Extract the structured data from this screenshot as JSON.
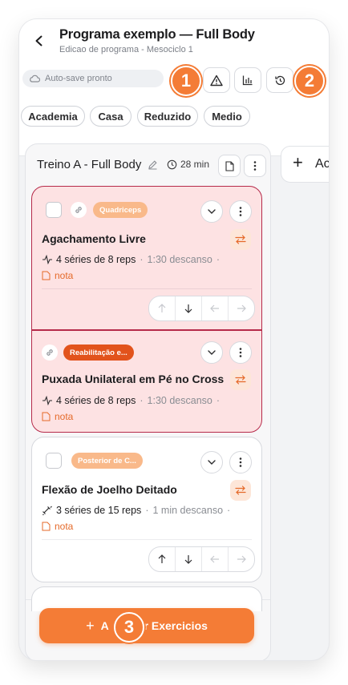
{
  "header": {
    "title": "Programa exemplo — Full Body",
    "subtitle": "Edicao de programa - Mesociclo 1",
    "autosave": "Auto-save pronto",
    "badge1": "1",
    "badge2": "2",
    "badge3": "3"
  },
  "chips": [
    "Academia",
    "Casa",
    "Reduzido",
    "Medio"
  ],
  "workout": {
    "title": "Treino A - Full Body",
    "duration": "28 min",
    "add_column": "Ac"
  },
  "exercises": [
    {
      "tag": "Quadriceps",
      "name": "Agachamento Livre",
      "sets": "4 séries de 8 reps",
      "rest": "1:30 descanso",
      "note": "nota"
    },
    {
      "tag": "Reabilitação e...",
      "name": "Puxada Unilateral em Pé no Cross",
      "sets": "4 séries de 8 reps",
      "rest": "1:30 descanso",
      "note": "nota"
    },
    {
      "tag": "Posterior de C...",
      "name": "Flexão de Joelho Deitado",
      "sets": "3 séries de 15 reps",
      "rest": "1 min descanso",
      "note": "nota"
    }
  ],
  "add_button": {
    "label_left": "A",
    "label_right": "ar Exercicios",
    "plus": "+"
  },
  "colors": {
    "accent": "#f47c36",
    "superset_border": "#b62a4a",
    "superset_bg": "#fde2e3",
    "tag_light": "#f9b98a",
    "tag_dark": "#e2531c"
  }
}
